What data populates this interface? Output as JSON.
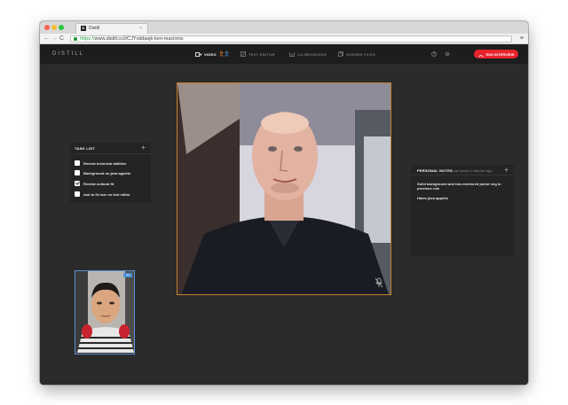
{
  "browser": {
    "tab_favicon": "D",
    "tab_title": "Distill",
    "url_scheme": "https://",
    "url_rest": "www.distill.cc/i/CJYxddaxjk-ken-macinnis"
  },
  "header": {
    "logo": "DISTILL",
    "nav": [
      {
        "label": "VIDEO",
        "icon": "video-camera-icon",
        "active": true
      },
      {
        "label": "TEXT EDITOR",
        "icon": "edit-icon",
        "active": false
      },
      {
        "label": "CO-BROWSING",
        "icon": "cobrowse-icon",
        "active": false
      },
      {
        "label": "SHARED FILES",
        "icon": "file-icon",
        "active": false
      }
    ],
    "end_button_label": "END INTERVIEW",
    "accent_color": "#e8232e"
  },
  "tasklist": {
    "title": "TASK LIST",
    "items": [
      {
        "label": "Review technical abilities",
        "checked": false
      },
      {
        "label": "Background on java applets",
        "checked": false
      },
      {
        "label": "Review cultural fit",
        "checked": true
      },
      {
        "label": "Ask to fix bux on text editor",
        "checked": false
      }
    ]
  },
  "notes": {
    "title": "PERSONAL NOTES",
    "saved": "Last saved 2 minutes ago",
    "items": [
      "Solid background and has mentored junior eng in previous role",
      "Hates java applets"
    ]
  }
}
